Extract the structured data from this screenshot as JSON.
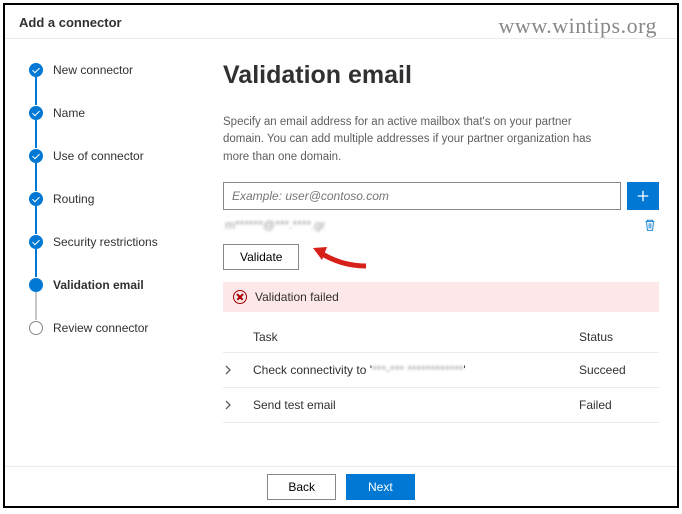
{
  "watermark": "www.wintips.org",
  "header": {
    "title": "Add a connector"
  },
  "steps": [
    {
      "label": "New connector",
      "state": "done"
    },
    {
      "label": "Name",
      "state": "done"
    },
    {
      "label": "Use of connector",
      "state": "done"
    },
    {
      "label": "Routing",
      "state": "done"
    },
    {
      "label": "Security restrictions",
      "state": "done"
    },
    {
      "label": "Validation email",
      "state": "current"
    },
    {
      "label": "Review connector",
      "state": "pending"
    }
  ],
  "main": {
    "title": "Validation email",
    "description": "Specify an email address for an active mailbox that's on your partner domain. You can add multiple addresses if your partner organization has more than one domain.",
    "input_placeholder": "Example: user@contoso.com",
    "added_email": "m******@***.****.gr",
    "validate_label": "Validate",
    "error_text": "Validation failed",
    "table": {
      "col_task": "Task",
      "col_status": "Status",
      "rows": [
        {
          "task_prefix": "Check connectivity to '",
          "task_blur": "***-*** ************",
          "task_suffix": "'",
          "status": "Succeed"
        },
        {
          "task_prefix": "Send test email",
          "task_blur": "",
          "task_suffix": "",
          "status": "Failed"
        }
      ]
    }
  },
  "footer": {
    "back": "Back",
    "next": "Next"
  }
}
